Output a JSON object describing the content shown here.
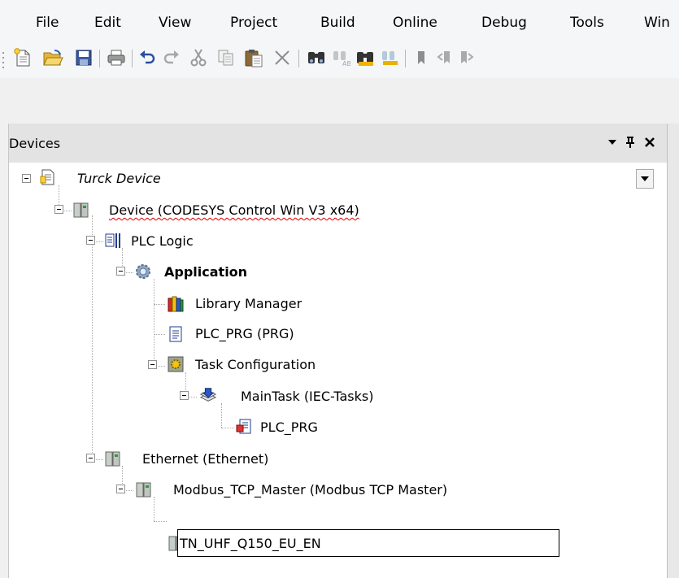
{
  "menu": {
    "items": [
      "File",
      "Edit",
      "View",
      "Project",
      "Build",
      "Online",
      "Debug",
      "Tools",
      "Win"
    ]
  },
  "toolbar": {
    "buttons": [
      "new-project-icon",
      "open-folder-icon",
      "save-icon",
      "print-icon",
      "undo-icon",
      "redo-icon",
      "cut-icon",
      "copy-icon",
      "paste-icon",
      "delete-icon",
      "find-icon",
      "replace-icon",
      "find-in-project-icon",
      "replace-in-project-icon",
      "bookmark-icon",
      "previous-bookmark-icon",
      "next-bookmark-icon"
    ]
  },
  "panel": {
    "title": "Devices",
    "header_buttons": [
      "dropdown-arrow-icon",
      "pin-icon",
      "close-icon"
    ]
  },
  "tree": {
    "root": "Turck Device",
    "device": "Device (CODESYS Control Win V3 x64)",
    "plc_logic": "PLC Logic",
    "application": "Application",
    "library_manager": "Library Manager",
    "plc_prg": "PLC_PRG (PRG)",
    "task_configuration": "Task Configuration",
    "main_task": "MainTask (IEC-Tasks)",
    "task_call": "PLC_PRG",
    "ethernet": "Ethernet (Ethernet)",
    "modbus_master": "Modbus_TCP_Master (Modbus TCP Master)",
    "rename_value": "TN_UHF_Q150_EU_EN"
  },
  "colors": {
    "error_underline": "#e00000",
    "panel_header": "#e3e3e3",
    "background": "#f0f0f0"
  }
}
